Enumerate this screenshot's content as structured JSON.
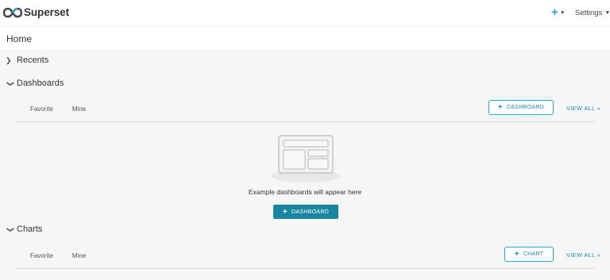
{
  "app": {
    "brand": "Superset",
    "plus_menu_icon": "plus-icon",
    "settings_label": "Settings"
  },
  "page": {
    "title": "Home"
  },
  "sections": {
    "recents": {
      "label": "Recents",
      "expanded": false
    },
    "dashboards": {
      "label": "Dashboards",
      "expanded": true,
      "tabs": [
        "Favorite",
        "Mine"
      ],
      "add_button": "DASHBOARD",
      "view_all": "VIEW ALL »",
      "empty_text": "Example dashboards will appear here",
      "empty_button": "DASHBOARD"
    },
    "charts": {
      "label": "Charts",
      "expanded": true,
      "tabs": [
        "Favorite",
        "Mine"
      ],
      "add_button": "CHART",
      "view_all": "VIEW ALL »"
    }
  },
  "colors": {
    "accent": "#20a7c9",
    "primary_button": "#1a85a0",
    "background": "#f6f6f6"
  }
}
